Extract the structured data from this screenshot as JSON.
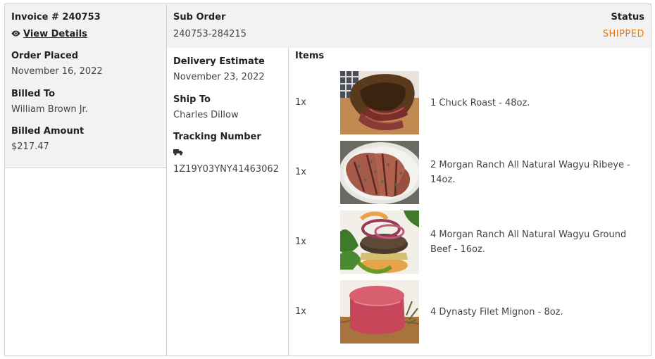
{
  "invoice": {
    "title": "Invoice # 240753",
    "view_details": "View Details",
    "order_placed_label": "Order Placed",
    "order_placed_value": "November 16, 2022",
    "billed_to_label": "Billed To",
    "billed_to_value": "William Brown Jr.",
    "billed_amount_label": "Billed Amount",
    "billed_amount_value": "$217.47"
  },
  "sub_order": {
    "label": "Sub Order",
    "value": "240753-284215",
    "status_label": "Status",
    "status_value": "SHIPPED",
    "status_color": "#e07b1e"
  },
  "delivery": {
    "estimate_label": "Delivery Estimate",
    "estimate_value": "November 23, 2022",
    "ship_to_label": "Ship To",
    "ship_to_value": "Charles Dillow",
    "tracking_label": "Tracking Number",
    "tracking_icon": "truck-icon",
    "tracking_value": "1Z19Y03YNY41463062"
  },
  "items": {
    "title": "Items",
    "list": [
      {
        "qty": "1x",
        "name": "1 Chuck Roast - 48oz.",
        "image": "chuck-roast-photo"
      },
      {
        "qty": "1x",
        "name": "2 Morgan Ranch All Natural Wagyu Ribeye - 14oz.",
        "image": "ribeye-photo"
      },
      {
        "qty": "1x",
        "name": "4 Morgan Ranch All Natural Wagyu Ground Beef - 16oz.",
        "image": "burger-photo"
      },
      {
        "qty": "1x",
        "name": "4 Dynasty Filet Mignon - 8oz.",
        "image": "filet-mignon-photo"
      }
    ]
  }
}
